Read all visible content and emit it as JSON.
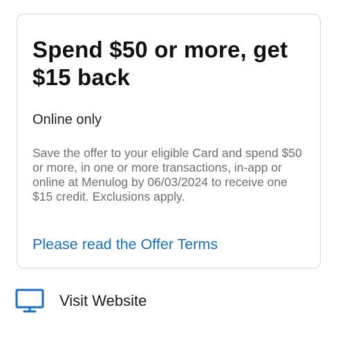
{
  "offer": {
    "title": "Spend $50 or more, get $15 back",
    "channel": "Online only",
    "description": "Save the offer to your eligible Card and spend $50 or more, in one or more transactions, in-app or online at Menulog by 06/03/2024 to receive one $15 credit. Exclusions apply.",
    "terms_link_label": "Please read the Offer Terms"
  },
  "actions": {
    "visit_website_label": "Visit Website",
    "visit_website_icon": "monitor-icon"
  },
  "colors": {
    "link": "#1a6ec0",
    "icon": "#1a6ec0",
    "description_text": "#6e6e6e",
    "card_border": "#d6d6d6"
  }
}
